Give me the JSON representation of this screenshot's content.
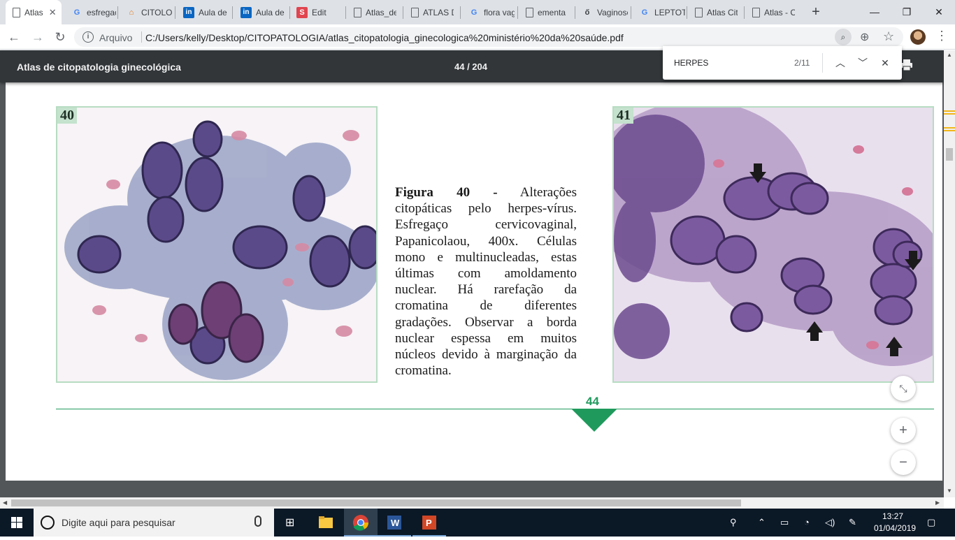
{
  "browser": {
    "tabs": [
      {
        "label": "Atlas",
        "icon": "document-icon",
        "active": true
      },
      {
        "label": "esfregaço",
        "icon": "google-icon"
      },
      {
        "label": "CITOLOGIA",
        "icon": "graduation-cap-icon"
      },
      {
        "label": "Aula de",
        "icon": "linkedin-icon"
      },
      {
        "label": "Aula de",
        "icon": "linkedin-icon"
      },
      {
        "label": "Edit",
        "icon": "s-app-icon"
      },
      {
        "label": "Atlas_de",
        "icon": "document-icon"
      },
      {
        "label": "ATLAS DE",
        "icon": "document-icon"
      },
      {
        "label": "flora vag",
        "icon": "google-icon"
      },
      {
        "label": "ementa",
        "icon": "document-icon"
      },
      {
        "label": "Vaginose",
        "icon": "app-icon"
      },
      {
        "label": "LEPTOTRI",
        "icon": "google-icon"
      },
      {
        "label": "Atlas Cit",
        "icon": "document-icon"
      },
      {
        "label": "Atlas - C",
        "icon": "document-icon"
      }
    ],
    "address": {
      "scheme_label": "Arquivo",
      "url": "C:/Users/kelly/Desktop/CITOPATOLOGIA/atlas_citopatologia_ginecologica%20ministério%20da%20saúde.pdf"
    }
  },
  "pdf": {
    "title": "Atlas de citopatologia ginecológica",
    "page_indicator": "44 / 204",
    "page_number_label": "44",
    "figures": [
      {
        "number": "40"
      },
      {
        "number": "41"
      }
    ],
    "caption_title": "Figura 40 -",
    "caption_body": "Alterações citopáticas pelo herpes-vírus. Esfregaço cervicovaginal, Papanicolaou, 400x. Células mono e multinucleadas, estas últimas com amoldamento nuclear. Há rarefação da cromatina de diferentes gradações. Observar a borda nuclear espessa em muitos núcleos devido à marginação da cromatina."
  },
  "find": {
    "query": "HERPES",
    "count": "2/11"
  },
  "taskbar": {
    "search_placeholder": "Digite aqui para pesquisar",
    "time": "13:27",
    "date": "01/04/2019"
  },
  "colors": {
    "pdf_accent": "#1f9a5c",
    "pdf_toolbar": "#323639",
    "taskbar": "#0b1826"
  }
}
